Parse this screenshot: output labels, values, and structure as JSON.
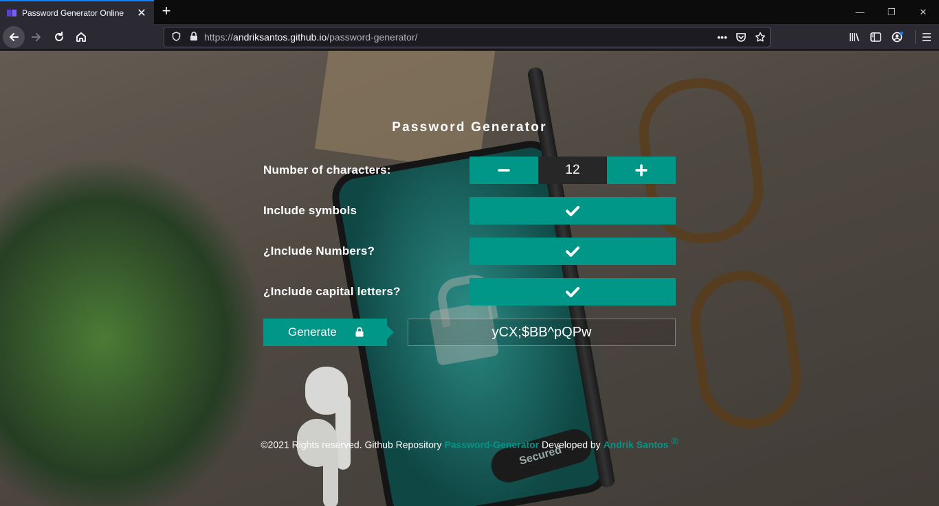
{
  "browser": {
    "tab_title": "Password Generator Online",
    "tab_close": "✕",
    "new_tab": "+",
    "window_controls": {
      "minimize": "—",
      "restore": "❐",
      "close": "✕"
    },
    "url_protocol": "https://",
    "url_host": "andriksantos.github.io",
    "url_path": "/password-generator/",
    "url_dots": "•••"
  },
  "app": {
    "title": "Password Generator",
    "rows": {
      "length": {
        "label": "Number of characters:",
        "value": "12"
      },
      "symbols": {
        "label": "Include symbols",
        "checked": true
      },
      "numbers": {
        "label": "¿Include Numbers?",
        "checked": true
      },
      "capitals": {
        "label": "¿Include capital letters?",
        "checked": true
      }
    },
    "generate_label": "Generate",
    "password": "yCX;$BB^pQPw"
  },
  "background": {
    "phone_label": "Secured"
  },
  "footer": {
    "prefix": "©2021 Rights reserved. Github Repository ",
    "repo": "Password-Generator",
    "middle": " Developed by ",
    "author": "Andrik Santos",
    "mark": "®"
  },
  "colors": {
    "accent": "#009688",
    "stepper_value_bg": "#272727",
    "chrome_bg": "#2b2a33",
    "tabbar_bg": "#0c0c0d"
  },
  "icons": [
    "back-arrow-icon",
    "forward-arrow-icon",
    "reload-icon",
    "home-icon",
    "shield-icon",
    "padlock-icon",
    "page-actions-icon",
    "pocket-icon",
    "bookmark-star-icon",
    "library-icon",
    "sidebar-icon",
    "account-icon",
    "menu-icon",
    "minus-icon",
    "plus-icon",
    "check-icon",
    "lock-icon"
  ]
}
